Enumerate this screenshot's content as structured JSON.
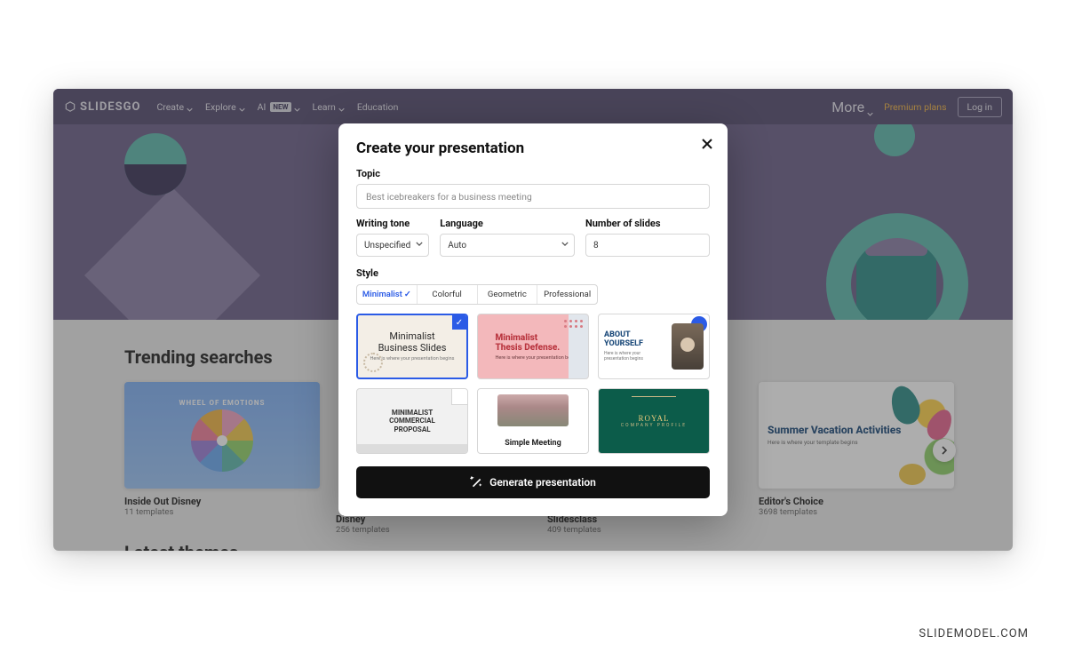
{
  "watermark": "SLIDEMODEL.COM",
  "logo": "SLIDESGO",
  "nav": {
    "create": "Create",
    "explore": "Explore",
    "ai": "AI",
    "ai_badge": "NEW",
    "learn": "Learn",
    "education": "Education",
    "more": "More",
    "premium": "Premium plans",
    "login": "Log in"
  },
  "trending": {
    "title": "Trending searches",
    "latest": "Latest themes",
    "cards": [
      {
        "thumb_title": "WHEEL OF EMOTIONS",
        "label": "Inside Out Disney",
        "count": "11 templates"
      },
      {
        "label": "Disney",
        "count": "256 templates"
      },
      {
        "label": "Slidesclass",
        "count": "409 templates"
      },
      {
        "thumb_title": "Summer Vacation Activities",
        "thumb_sub": "Here is where your template begins",
        "label": "Editor's Choice",
        "count": "3698 templates"
      }
    ]
  },
  "modal": {
    "title": "Create your presentation",
    "topic_label": "Topic",
    "topic_placeholder": "Best icebreakers for a business meeting",
    "tone_label": "Writing tone",
    "tone_value": "Unspecified",
    "lang_label": "Language",
    "lang_value": "Auto",
    "slides_label": "Number of slides",
    "slides_value": "8",
    "style_label": "Style",
    "tabs": {
      "minimalist": "Minimalist",
      "colorful": "Colorful",
      "geometric": "Geometric",
      "professional": "Professional"
    },
    "generate": "Generate presentation",
    "thumbs": {
      "t1a": "Minimalist",
      "t1b": "Business Slides",
      "t1c": "Here is where your presentation begins",
      "t2a": "Minimalist",
      "t2b": "Thesis Defense.",
      "t2c": "Here is where your presentation begins",
      "t3a": "ABOUT",
      "t3b": "YOURSELF",
      "t3c": "Here is where your presentation begins",
      "t4a": "MINIMALIST",
      "t4b": "COMMERCIAL",
      "t4c": "PROPOSAL",
      "t5a": "Simple Meeting",
      "t6a": "ROYAL",
      "t6b": "COMPANY PROFILE"
    }
  }
}
